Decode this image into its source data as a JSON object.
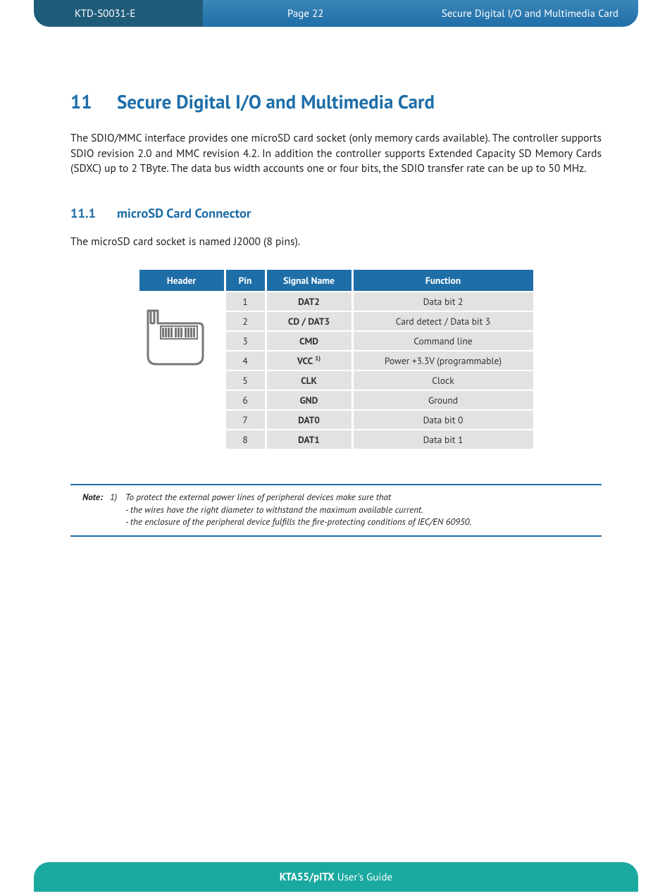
{
  "header": {
    "doc_code": "KTD-S0031-E",
    "page": "Page 22",
    "title": "Secure Digital I/O and Multimedia Card"
  },
  "section": {
    "number": "11",
    "title": "Secure Digital I/O and Multimedia Card",
    "body": "The SDIO/MMC interface provides one microSD card socket (only memory cards available). The controller supports SDIO revision 2.0 and MMC revision 4.2. In addition the controller supports Extended Capacity SD Memory Cards (SDXC) up to 2 TByte. The data bus width accounts one or four bits, the SDIO transfer rate can be up to 50 MHz."
  },
  "subsection": {
    "number": "11.1",
    "title": "microSD Card Connector",
    "body": "The microSD card socket is named J2000 (8 pins)."
  },
  "table": {
    "headers": {
      "c1": "Header",
      "c2": "Pin",
      "c3": "Signal Name",
      "c4": "Function"
    },
    "rows": [
      {
        "pin": "1",
        "signal": "DAT2",
        "func": "Data bit 2"
      },
      {
        "pin": "2",
        "signal": "CD / DAT3",
        "func": "Card detect / Data bit 3"
      },
      {
        "pin": "3",
        "signal": "CMD",
        "func": "Command line"
      },
      {
        "pin": "4",
        "signal": "VCC",
        "signal_sup": "1)",
        "func": "Power +3.3V (programmable)"
      },
      {
        "pin": "5",
        "signal": "CLK",
        "func": "Clock"
      },
      {
        "pin": "6",
        "signal": "GND",
        "func": "Ground"
      },
      {
        "pin": "7",
        "signal": "DAT0",
        "func": "Data bit 0"
      },
      {
        "pin": "8",
        "signal": "DAT1",
        "func": "Data bit 1"
      }
    ]
  },
  "note": {
    "label": "Note:",
    "num": "1)",
    "line1": "To protect the external power lines of peripheral devices make sure that",
    "line2": "- the wires have the right diameter to withstand the maximum available current.",
    "line3": "- the enclosure of the peripheral device fulfills the fire-protecting conditions of IEC/EN 60950."
  },
  "footer": {
    "bold": "KTA55/pITX",
    "rest": " User's Guide"
  }
}
